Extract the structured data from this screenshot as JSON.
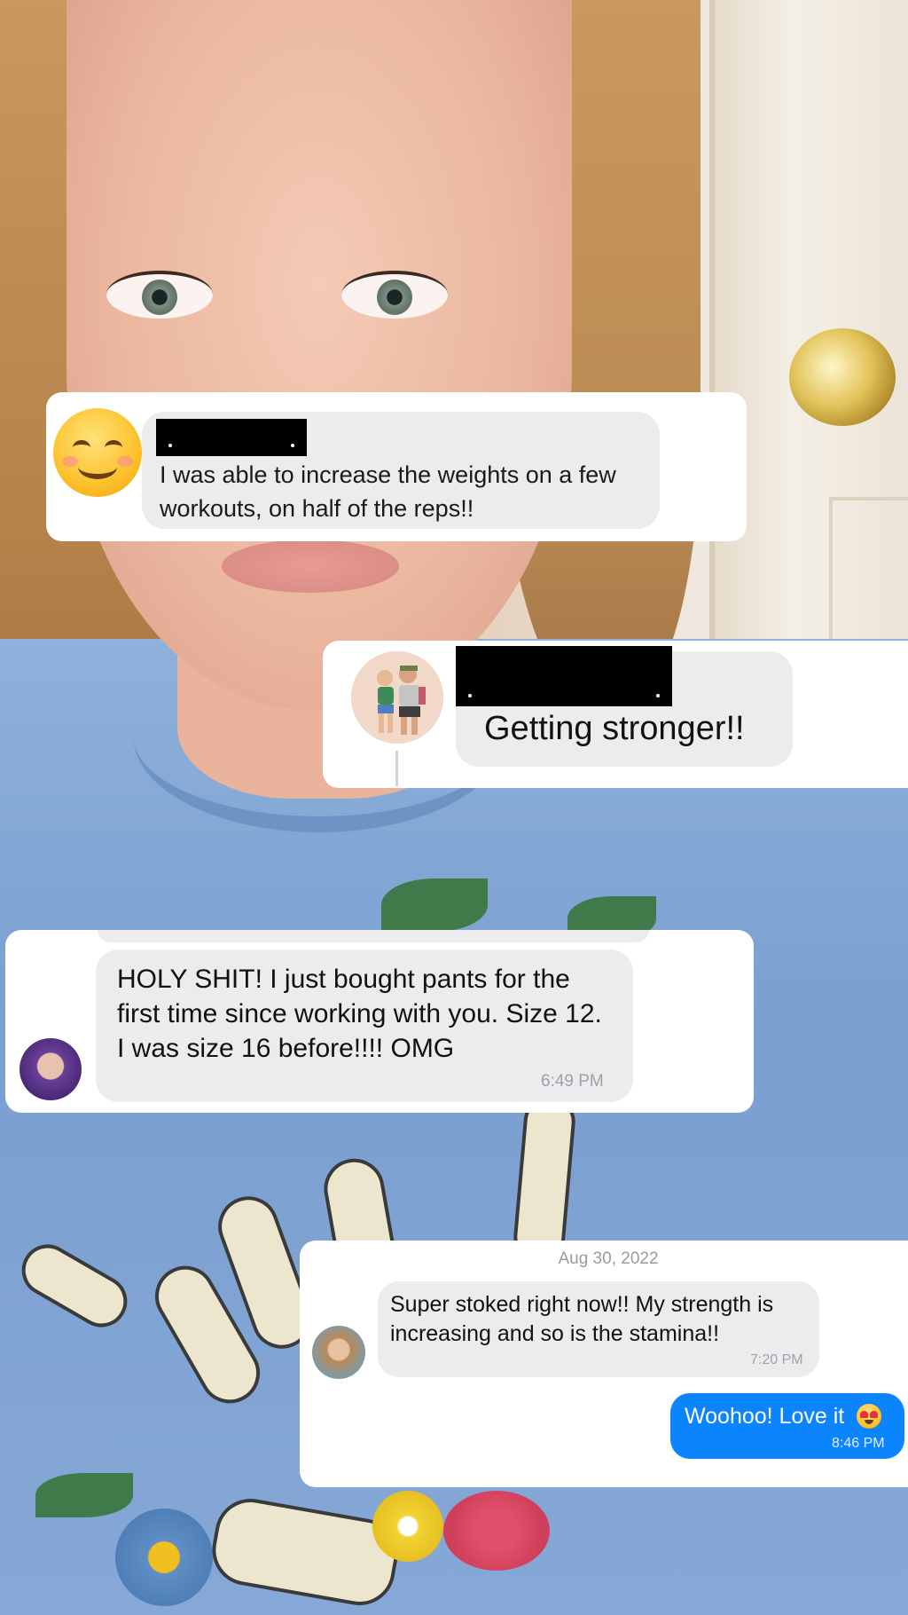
{
  "messages": [
    {
      "id": "m1",
      "text": "I was able to increase the weights on a few workouts, on half of the reps!!"
    },
    {
      "id": "m2",
      "text": "Getting stronger!!"
    },
    {
      "id": "m3",
      "text": "HOLY SHIT!  I just bought pants for the first time since working with you. Size 12. I was size 16 before!!!! OMG",
      "time": "6:49 PM"
    },
    {
      "id": "m4",
      "date": "Aug 30, 2022",
      "text": "Super stoked right now!! My strength is increasing and so is the stamina!!",
      "time": "7:20 PM",
      "reply": {
        "text": "Woohoo! Love it",
        "time": "8:46 PM"
      }
    }
  ],
  "icons": {
    "emoji_avatar": "smiling-face-icon",
    "reply_emoji": "heart-eyes-icon"
  },
  "colors": {
    "sent_bubble": "#0b84fe",
    "received_bubble": "#ececee",
    "redaction": "#000000"
  }
}
